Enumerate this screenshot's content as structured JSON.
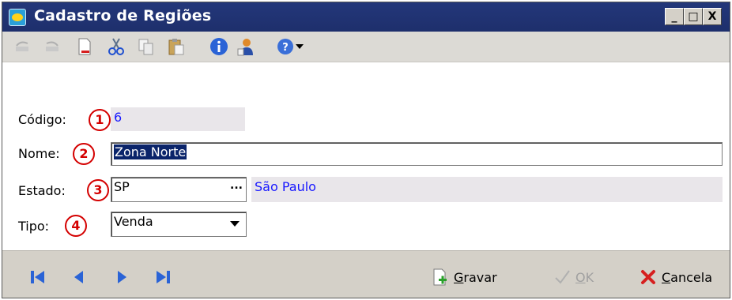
{
  "window": {
    "title": "Cadastro de Regiões",
    "controls": {
      "minimize": "_",
      "maximize": "□",
      "close": "X"
    }
  },
  "toolbar": {
    "items": [
      {
        "icon": "undo-icon",
        "enabled": false
      },
      {
        "icon": "redo-icon",
        "enabled": false
      },
      {
        "icon": "delete-record-icon",
        "enabled": true
      },
      {
        "icon": "cut-icon",
        "enabled": true
      },
      {
        "icon": "copy-icon",
        "enabled": true
      },
      {
        "icon": "paste-icon",
        "enabled": true
      },
      {
        "icon": "info-icon",
        "enabled": true
      },
      {
        "icon": "user-icon",
        "enabled": true
      },
      {
        "icon": "help-icon",
        "enabled": true
      }
    ]
  },
  "form": {
    "codigo": {
      "label": "Código:",
      "marker": "1",
      "value": "6"
    },
    "nome": {
      "label": "Nome:",
      "marker": "2",
      "value": "Zona Norte"
    },
    "estado": {
      "label": "Estado:",
      "marker": "3",
      "value": "SP",
      "lookup_button": "...",
      "description": "São Paulo"
    },
    "tipo": {
      "label": "Tipo:",
      "marker": "4",
      "value": "Venda"
    }
  },
  "navigation": [
    "first-record-icon",
    "previous-record-icon",
    "next-record-icon",
    "last-record-icon"
  ],
  "actions": {
    "gravar": {
      "accel": "G",
      "rest": "ravar"
    },
    "ok": {
      "accel": "O",
      "rest": "K"
    },
    "cancela": {
      "accel": "C",
      "rest": "ancela"
    }
  },
  "colors": {
    "titlebar": "#23377a",
    "readonly_bg": "#e9e6ea",
    "readonly_text": "#1a1aff",
    "marker": "#d40000",
    "selection": "#0a246a"
  }
}
